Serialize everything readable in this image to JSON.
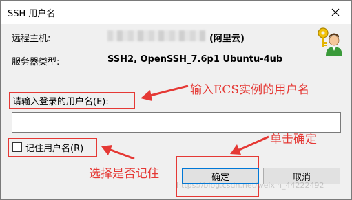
{
  "window": {
    "title": "SSH 用户名"
  },
  "info": {
    "host_label": "远程主机:",
    "host_suffix": "(阿里云)",
    "server_type_label": "服务器类型:",
    "server_type_value": "SSH2, OpenSSH_7.6p1 Ubuntu-4ub"
  },
  "form": {
    "prompt_label": "请输入登录的用户名(E):",
    "username_value": "",
    "remember_label": "记住用户名(R)",
    "remember_checked": false
  },
  "buttons": {
    "ok_label": "确定",
    "cancel_label": "取消"
  },
  "annotations": {
    "username_note": "输入ECS实例的用户名",
    "confirm_note": "单击确定",
    "remember_note": "选择是否记住"
  },
  "watermark": "https://blog.csdn.net/weixin_44222492",
  "colors": {
    "annotation": "#e53935",
    "default_button_border": "#0078d7"
  },
  "icons": {
    "close": "close-icon",
    "app": "keys-user-icon",
    "arrow": "arrow-icon"
  }
}
